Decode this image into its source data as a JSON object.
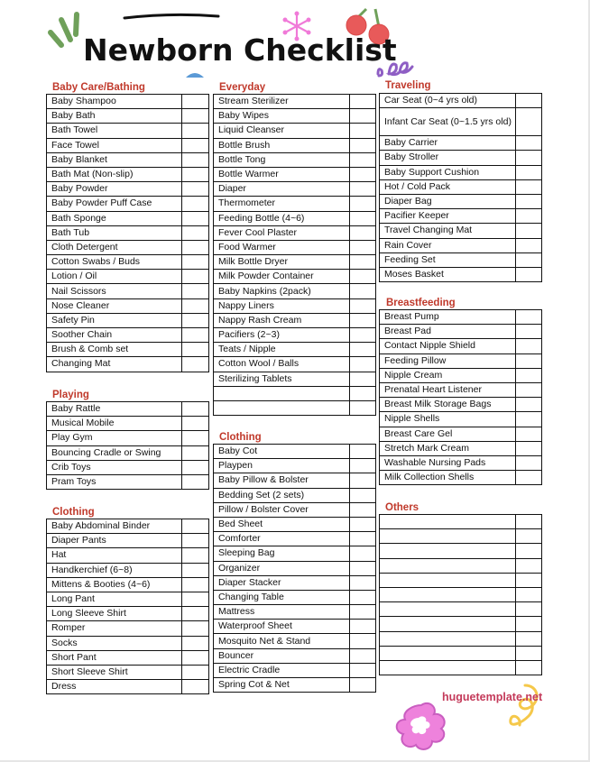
{
  "title": "Newborn Checklist",
  "watermark": "huguetemplate.net",
  "colors": {
    "section_title": "#c0392b",
    "watermark": "#c43a5a",
    "border": "#111111"
  },
  "sections": {
    "baby_care": {
      "title": "Baby Care/Bathing",
      "items": [
        "Baby Shampoo",
        "Baby Bath",
        "Bath Towel",
        "Face Towel",
        "Baby Blanket",
        "Bath Mat (Non-slip)",
        "Baby Powder",
        "Baby Powder Puff Case",
        "Bath Sponge",
        "Bath Tub",
        "Cloth Detergent",
        "Cotton Swabs / Buds",
        "Lotion / Oil",
        "Nail Scissors",
        "Nose Cleaner",
        "Safety Pin",
        "Soother Chain",
        "Brush & Comb set",
        "Changing Mat"
      ]
    },
    "playing": {
      "title": "Playing",
      "items": [
        "Baby Rattle",
        "Musical Mobile",
        "Play Gym",
        "Bouncing Cradle or Swing",
        "Crib Toys",
        "Pram Toys"
      ]
    },
    "clothing_left": {
      "title": "Clothing",
      "items": [
        "Baby Abdominal Binder",
        "Diaper Pants",
        "Hat",
        "Handkerchief (6~8)",
        "Mittens & Booties (4~6)",
        "Long Pant",
        "Long Sleeve Shirt",
        "Romper",
        "Socks",
        "Short Pant",
        "Short Sleeve Shirt",
        "Dress"
      ]
    },
    "everyday": {
      "title": "Everyday",
      "items": [
        "Stream Sterilizer",
        "Baby Wipes",
        "Liquid Cleanser",
        "Bottle Brush",
        "Bottle Tong",
        "Bottle Warmer",
        "Diaper",
        "Thermometer",
        "Feeding Bottle (4~6)",
        "Fever Cool Plaster",
        "Food Warmer",
        "Milk Bottle Dryer",
        "Milk Powder Container",
        "Baby Napkins (2pack)",
        "Nappy Liners",
        "Nappy Rash Cream",
        "Pacifiers (2~3)",
        "Teats / Nipple",
        "Cotton Wool / Balls",
        "Sterilizing Tablets",
        "",
        ""
      ]
    },
    "clothing_middle": {
      "title": "Clothing",
      "items": [
        "Baby Cot",
        "Playpen",
        "Baby Pillow & Bolster",
        "Bedding Set (2 sets)",
        "Pillow / Bolster Cover",
        "Bed Sheet",
        "Comforter",
        "Sleeping Bag",
        "Organizer",
        "Diaper Stacker",
        "Changing Table",
        "Mattress",
        "Waterproof Sheet",
        "Mosquito Net & Stand",
        "Bouncer",
        "Electric Cradle",
        "Spring Cot & Net"
      ]
    },
    "traveling": {
      "title": "Traveling",
      "items": [
        "Car Seat (0~4 yrs old)",
        "Infant Car Seat (0~1.5 yrs old)",
        "Baby Carrier",
        "Baby Stroller",
        "Baby Support Cushion",
        "Hot / Cold Pack",
        "Diaper Bag",
        "Pacifier Keeper",
        "Travel Changing Mat",
        "Rain Cover",
        "Feeding Set",
        "Moses Basket"
      ]
    },
    "breastfeeding": {
      "title": "Breastfeeding",
      "items": [
        "Breast Pump",
        "Breast Pad",
        "Contact Nipple Shield",
        "Feeding Pillow",
        "Nipple Cream",
        "Prenatal Heart Listener",
        "Breast Milk Storage Bags",
        "Nipple Shells",
        "Breast Care Gel",
        "Stretch Mark Cream",
        "Washable Nursing Pads",
        "Milk Collection Shells"
      ]
    },
    "others": {
      "title": "Others",
      "items": [
        "",
        "",
        "",
        "",
        "",
        "",
        "",
        "",
        "",
        "",
        ""
      ]
    }
  }
}
